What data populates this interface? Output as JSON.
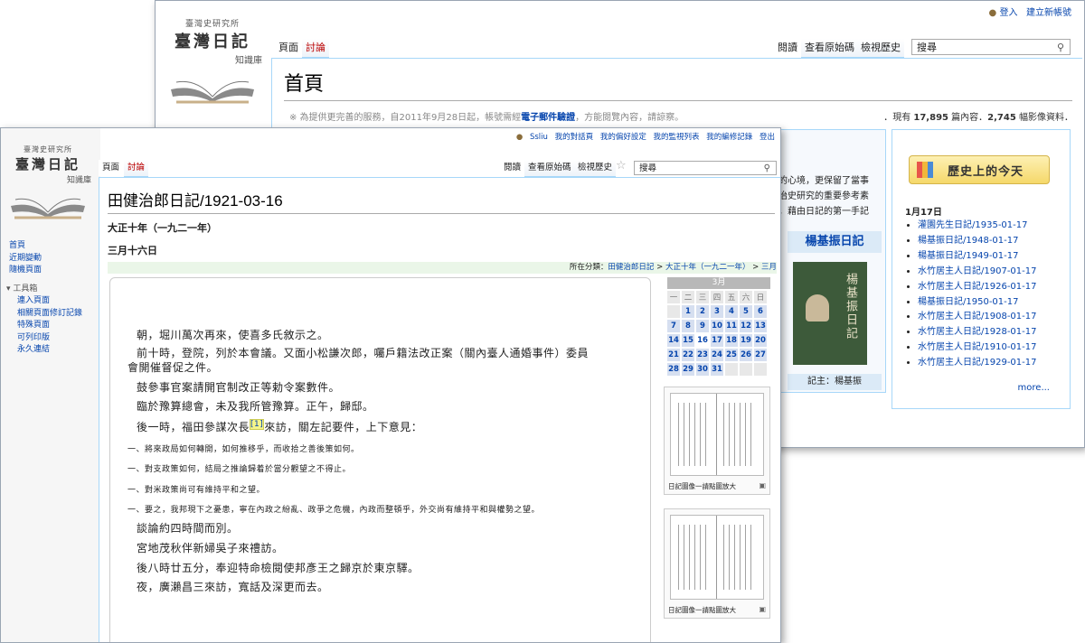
{
  "back": {
    "logo": {
      "institute": "臺灣史研究所",
      "title": "臺灣日記",
      "subtitle": "知識庫"
    },
    "user_links": {
      "login": "登入",
      "create_account": "建立新帳號"
    },
    "tabs": {
      "page": "頁面",
      "talk": "討論",
      "read": "閱讀",
      "view_source": "查看原始碼",
      "history": "檢視歷史"
    },
    "search_placeholder": "搜尋",
    "page_title": "首頁",
    "notice_prefix": "※ 為提供更完善的服務，自2011年9月28日起，帳號需經",
    "notice_link": "電子郵件驗證",
    "notice_suffix": "，方能閱覽內容，請諒察。",
    "stats_prefix": "．現有",
    "stats_articles": "17,895",
    "stats_mid": "篇內容．",
    "stats_images": "2,745",
    "stats_suffix": "幅影像資料．",
    "intro_lines": [
      "的心境，更保留了當事",
      "治史研究的重要參考素",
      "，藉由日記的第一手記"
    ],
    "featured_title": "楊基振日記",
    "featured_caption": "記主：楊基振",
    "book_cover_text": "楊基振日記",
    "today_banner": "歷史上的今天",
    "today_date": "1月17日",
    "today_list": [
      "灌園先生日記/1935-01-17",
      "楊基振日記/1948-01-17",
      "楊基振日記/1949-01-17",
      "水竹居主人日記/1907-01-17",
      "水竹居主人日記/1926-01-17",
      "楊基振日記/1950-01-17",
      "水竹居主人日記/1908-01-17",
      "水竹居主人日記/1928-01-17",
      "水竹居主人日記/1910-01-17",
      "水竹居主人日記/1929-01-17"
    ],
    "more": "more..."
  },
  "front": {
    "logo": {
      "institute": "臺灣史研究所",
      "title": "臺灣日記",
      "subtitle": "知識庫"
    },
    "user_links": [
      "Ssliu",
      "我的對話頁",
      "我的偏好設定",
      "我的監視列表",
      "我的編修記錄",
      "登出"
    ],
    "tabs": {
      "page": "頁面",
      "talk": "討論",
      "read": "閱讀",
      "view_source": "查看原始碼",
      "history": "檢視歷史"
    },
    "search_placeholder": "搜尋",
    "page_title": "田健治郎日記/1921-03-16",
    "sidebar_nav": [
      "首頁",
      "近期變動",
      "隨機頁面"
    ],
    "toolbox_title": "工具箱",
    "toolbox": [
      "連入頁面",
      "相關頁面修訂記錄",
      "特殊頁面",
      "可列印版",
      "永久連結"
    ],
    "era": "大正十年（一九二一年）",
    "date": "三月十六日",
    "category_label": "所在分類：",
    "category_links": [
      "田健治郎日記",
      "大正十年（一九二一年）",
      "三月"
    ],
    "category_sep": ">",
    "paragraphs": [
      "朝，堀川萬次再來，使喜多氏敘示之。",
      "前十時，登院，列於本會議。又面小松謙次郎，囑戶籍法改正案（關內臺人通婚事件）委員",
      "會開催督促之件。",
      "鼓參事官案請開官制改正等勅令案數件。",
      "臨於豫算總會，未及我所管豫算。正午，歸邸。",
      "來訪，關左記要件，上下意見：",
      "一、將來政局如何轉開，如何推移乎，而收拾之善後策如何。",
      "一、對支政策如何，結局之推論歸着於當分觀望之不得止。",
      "一、對米政策尚可有維持平和之望。",
      "一、要之，我邦現下之憂患，寧在內政之紛亂、政爭之危機，內政而整頓乎，外交尚有維持平和與權勢之望。",
      "談論約四時間而別。",
      "宮地茂秋伴新婦吳子來禮訪。",
      "後八時廿五分，奉迎特命檢閱使邦彥王之歸京於東京驛。",
      "夜，廣瀨昌三來訪，寬話及深更而去。"
    ],
    "p_visit_prefix": "後一時，福田參謀次長",
    "footnote": "[1]",
    "calendar": {
      "month": "3月",
      "weekdays": [
        "一",
        "二",
        "三",
        "四",
        "五",
        "六",
        "日"
      ],
      "weeks": [
        [
          "",
          "1",
          "2",
          "3",
          "4",
          "5",
          "6"
        ],
        [
          "7",
          "8",
          "9",
          "10",
          "11",
          "12",
          "13"
        ],
        [
          "14",
          "15",
          "16",
          "17",
          "18",
          "19",
          "20"
        ],
        [
          "21",
          "22",
          "23",
          "24",
          "25",
          "26",
          "27"
        ],
        [
          "28",
          "29",
          "30",
          "31",
          "",
          "",
          ""
        ]
      ],
      "current": "16"
    },
    "image_caption": "日記圖像一請點圖放大"
  },
  "colors": {
    "link": "#0645ad",
    "tab_border": "#a7d7f9",
    "calendar_header": "#b8b8b8",
    "calendar_cell": "#d6dff0",
    "category_bar": "#eaf6e8",
    "gold_banner": "#f5d86a",
    "featured_box": "#dbeaf7"
  }
}
